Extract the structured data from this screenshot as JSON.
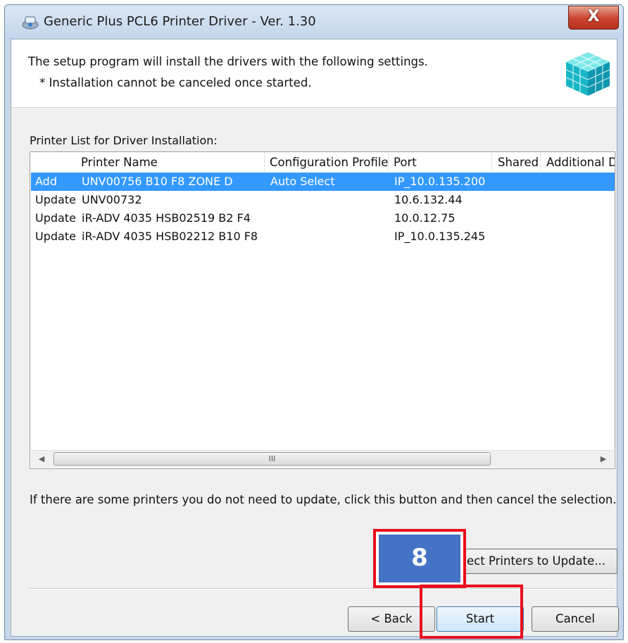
{
  "window": {
    "title": "Generic Plus PCL6 Printer Driver - Ver. 1.30",
    "close_glyph": "X"
  },
  "header": {
    "line1": "The setup program will install the drivers with the following settings.",
    "line2": "* Installation cannot be canceled once started."
  },
  "list": {
    "label": "Printer List for Driver Installation:",
    "columns": [
      "Printer Name",
      "Configuration Profile",
      "Port",
      "Shared",
      "Additional D"
    ],
    "rows": [
      {
        "action": "Add",
        "name": "UNV00756 B10 F8 ZONE D",
        "profile": "Auto Select",
        "port": "IP_10.0.135.200",
        "selected": true
      },
      {
        "action": "Update",
        "name": "UNV00732",
        "profile": "",
        "port": "10.6.132.44",
        "selected": false
      },
      {
        "action": "Update",
        "name": "iR-ADV 4035 HSB02519 B2 F4",
        "profile": "",
        "port": "10.0.12.75",
        "selected": false
      },
      {
        "action": "Update",
        "name": "iR-ADV 4035 HSB02212 B10 F8",
        "profile": "",
        "port": "IP_10.0.135.245",
        "selected": false
      }
    ],
    "scroll": {
      "left_arrow": "◀",
      "right_arrow": "▶",
      "grip": "III"
    }
  },
  "hint": "If there are some printers you do not need to update, click this button and then cancel the selection.",
  "buttons": {
    "select_printers": "ect Printers to Update...",
    "back": "< Back",
    "start": "Start",
    "cancel": "Cancel"
  },
  "annotation": {
    "step_number": "8",
    "color": "#e8101c",
    "badge_color": "#4472c4"
  },
  "colors": {
    "selection": "#3399ff"
  }
}
